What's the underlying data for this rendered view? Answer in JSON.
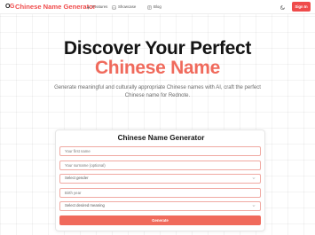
{
  "header": {
    "logo_text": "OG",
    "brand": "Chinese Name Generator",
    "nav": [
      {
        "label": "Features",
        "icon": "sparkle-icon"
      },
      {
        "label": "Showcase",
        "icon": "image-icon"
      },
      {
        "label": "Blog",
        "icon": "document-icon"
      }
    ],
    "theme_icon": "theme-toggle-icon",
    "sign_in": "Sign In"
  },
  "hero": {
    "line1": "Discover Your Perfect",
    "line2": "Chinese Name",
    "subtitle": "Generate meaningful and culturally appropriate Chinese names with AI, craft the perfect Chinese name for Rednote."
  },
  "form": {
    "title": "Chinese Name Generator",
    "first_name_placeholder": "Your first name",
    "surname_placeholder": "Your surname (optional)",
    "gender_select": "Select gender",
    "birth_year_placeholder": "Birth year",
    "meaning_select": "Select desired meaning",
    "generate": "Generate"
  },
  "colors": {
    "accent": "#ef4b4b",
    "accent_light": "#f06a5c",
    "field_border": "#f0a9a2"
  }
}
